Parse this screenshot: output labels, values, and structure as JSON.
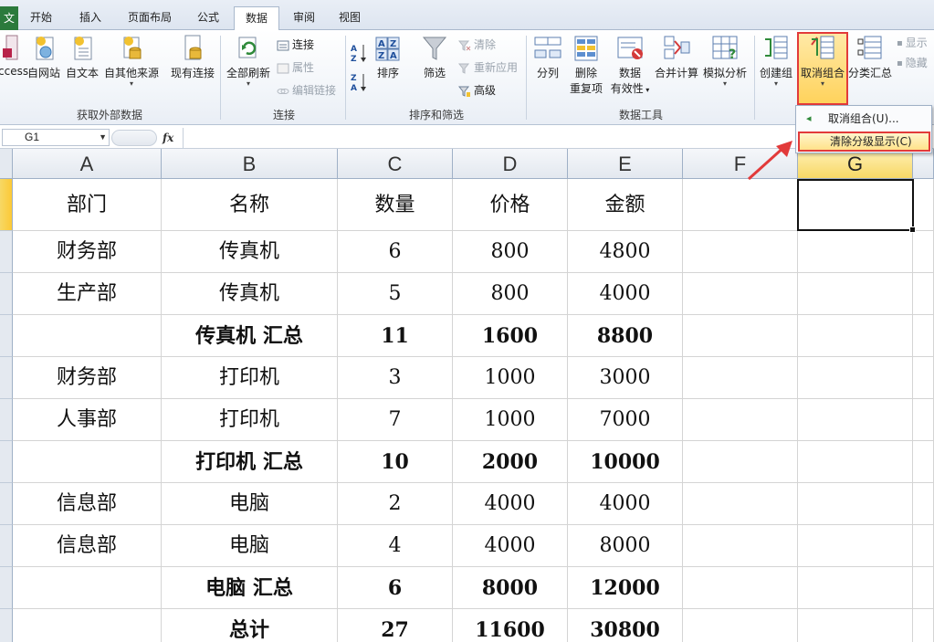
{
  "tabs": {
    "file": "文",
    "items": [
      "开始",
      "插入",
      "页面布局",
      "公式",
      "数据",
      "审阅",
      "视图"
    ],
    "active_index": 4
  },
  "ribbon": {
    "groups": {
      "external": "获取外部数据",
      "connections": "连接",
      "sort_filter": "排序和筛选",
      "tools": "数据工具"
    },
    "external": {
      "access": "Access",
      "web": "自网站",
      "text": "自文本",
      "other": "自其他来源",
      "existing": "现有连接"
    },
    "connections": {
      "refresh_all": "全部刷新",
      "connections": "连接",
      "properties": "属性",
      "edit_links": "编辑链接"
    },
    "sort_filter": {
      "sort": "排序",
      "filter": "筛选",
      "clear": "清除",
      "reapply": "重新应用",
      "advanced": "高级"
    },
    "tools": {
      "text_to_columns": "分列",
      "remove_dup_1": "删除",
      "remove_dup_2": "重复项",
      "validation_1": "数据",
      "validation_2": "有效性",
      "consolidate": "合并计算",
      "what_if": "模拟分析"
    },
    "outline": {
      "group": "创建组",
      "ungroup": "取消组合",
      "subtotal": "分类汇总",
      "show_detail": "显示",
      "hide_detail": "隐藏"
    }
  },
  "formula_bar": {
    "name_box": "G1",
    "fx": "fx",
    "value": ""
  },
  "menu": {
    "items": [
      "取消组合(U)...",
      "清除分级显示(C)"
    ],
    "highlighted_index": 1
  },
  "columns": [
    "A",
    "B",
    "C",
    "D",
    "E",
    "F",
    "G"
  ],
  "selected_column": "G",
  "table": {
    "header": [
      "部门",
      "名称",
      "数量",
      "价格",
      "金额"
    ],
    "rows": [
      [
        "财务部",
        "传真机",
        "6",
        "800",
        "4800"
      ],
      [
        "生产部",
        "传真机",
        "5",
        "800",
        "4000"
      ],
      [
        "",
        "传真机 汇总",
        "11",
        "1600",
        "8800"
      ],
      [
        "财务部",
        "打印机",
        "3",
        "1000",
        "3000"
      ],
      [
        "人事部",
        "打印机",
        "7",
        "1000",
        "7000"
      ],
      [
        "",
        "打印机 汇总",
        "10",
        "2000",
        "10000"
      ],
      [
        "信息部",
        "电脑",
        "2",
        "4000",
        "4000"
      ],
      [
        "信息部",
        "电脑",
        "4",
        "4000",
        "8000"
      ],
      [
        "",
        "电脑 汇总",
        "6",
        "8000",
        "12000"
      ],
      [
        "",
        "总计",
        "27",
        "11600",
        "30800"
      ]
    ],
    "bold_rows": [
      2,
      5,
      8,
      9
    ]
  },
  "colors": {
    "highlight_red": "#e23a3a",
    "selected_header": "#f7d865",
    "file_tab": "#2b7a3c"
  }
}
